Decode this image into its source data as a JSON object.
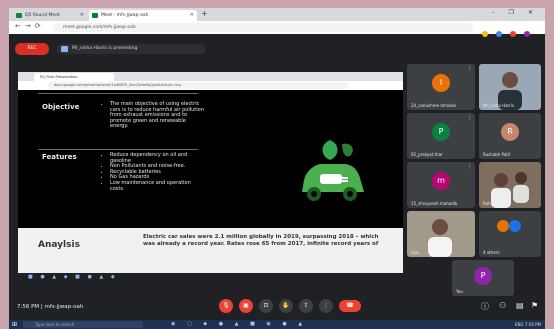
{
  "browser": {
    "tabs": [
      {
        "label": "Q5 Round Meet",
        "fav_color": "#188038"
      },
      {
        "label": "Meet - mfs-jjwap-oah",
        "fav_color": "#00832d"
      }
    ],
    "new_tab": "+",
    "url": "meet.google.com/mfs-jjwap-oah",
    "window_controls": "– ❐ ✕"
  },
  "meet": {
    "rec_label": "REC",
    "presenting_label": "Mr_nisha Harris is presenting",
    "time": "7:56 PM  |  mfs-jjwap-oah",
    "end_call_icon": "phone-hangup-icon"
  },
  "shared_screen": {
    "inner_tab": "EV_Final Presentation",
    "inner_url": "docs.google.com/presentation/d/1wBSlKTl_5ex0Q4w8pQ/edit#slide=id.p",
    "slide": {
      "objective_label": "Objective",
      "objective_text": "The main objective of using electric cars is to reduce harmful air pollution from exhaust emissions and to promote green and renewable energy.",
      "features_label": "Features",
      "features": [
        "Reduce dependency on oil and gasoline",
        "Non Pollutants and noise-free.",
        "Recyclable batteries",
        "No Gas hazards",
        "Low maintenance and operation costs."
      ],
      "analysis_label": "Anaylsis",
      "analysis_text": "Electric car sales were 2.1 million globally in 2019, surpassing 2018 – which was already a record year. Rates rose 65 from 2017, infinite record years of"
    }
  },
  "participants": [
    {
      "name": "24_vanushree mhaske",
      "initial": "I",
      "color": "#e8710a"
    },
    {
      "name": "Mr_nisha Harris",
      "initial": "",
      "color": ""
    },
    {
      "name": "05_prakyat thar",
      "initial": "P",
      "color": "#0b8043"
    },
    {
      "name": "Rushabh Patil",
      "initial": "R",
      "color": "#c5866b"
    },
    {
      "name": "15_shreyansh mahadik",
      "initial": "m",
      "color": "#b80672"
    },
    {
      "name": "Rahul",
      "initial": "",
      "color": ""
    },
    {
      "name": "Ajay",
      "initial": "",
      "color": ""
    },
    {
      "name": "4 others",
      "initial": "",
      "color": "#e37400"
    },
    {
      "name": "You",
      "initial": "P",
      "color": "#8e24aa"
    }
  ],
  "taskbar": {
    "search_placeholder": "Type here to search",
    "tray_text": "ENG  7:56 PM"
  }
}
